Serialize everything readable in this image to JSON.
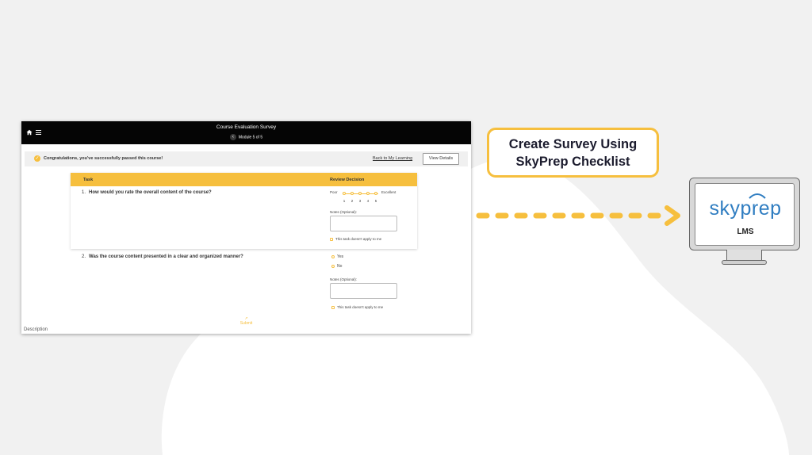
{
  "colors": {
    "accent": "#f6bf3e",
    "topbar": "#050505",
    "brand_blue": "#2f7dc1"
  },
  "app": {
    "title": "Course Evaluation Survey",
    "module": "Module 5 of 5",
    "icons": {
      "home": "home-icon",
      "menu": "hamburger-menu-icon",
      "back": "chevron-left-icon"
    }
  },
  "banner": {
    "message": "Congratulations, you've successfully passed this course!",
    "back_link": "Back to My Learning",
    "view_details": "View Details"
  },
  "table": {
    "col_task": "Task",
    "col_review": "Review Decision"
  },
  "questions": [
    {
      "number": "1.",
      "text": "How would you rate the overall content of the course?",
      "rating": {
        "low_label": "Poor",
        "high_label": "Excellent",
        "scale": [
          "1",
          "2",
          "3",
          "4",
          "5"
        ]
      },
      "notes_label": "Notes (Optional):",
      "na_label": "This task doesn't apply to me"
    },
    {
      "number": "2.",
      "text": "Was the course content presented in a clear and organized manner?",
      "options": [
        "Yes",
        "No"
      ],
      "notes_label": "Notes (Optional):",
      "na_label": "This task doesn't apply to me"
    }
  ],
  "footer": {
    "submit": "Submit",
    "description": "Description"
  },
  "callout": {
    "line1": "Create Survey Using",
    "line2": "SkyPrep Checklist"
  },
  "logo": {
    "brand": "skyprep",
    "product": "LMS"
  }
}
